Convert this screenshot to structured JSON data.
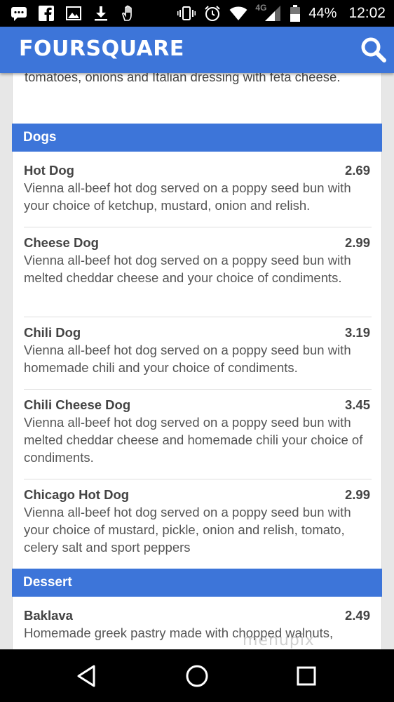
{
  "status_bar": {
    "network": "4G",
    "battery": "44%",
    "time": "12:02"
  },
  "app": {
    "title": "FOURSQUARE"
  },
  "previous_item": {
    "desc_tail": "tomatoes, onions and Italian dressing with feta cheese."
  },
  "sections": [
    {
      "title": "Dogs",
      "items": [
        {
          "name": "Hot Dog",
          "price": "2.69",
          "desc": "Vienna all-beef hot dog served on a poppy seed bun with your choice of ketchup, mustard, onion and relish."
        },
        {
          "name": "Cheese Dog",
          "price": "2.99",
          "desc": "Vienna all-beef hot dog served on a poppy seed bun with melted cheddar cheese and your choice of condiments."
        },
        {
          "name": "Chili Dog",
          "price": "3.19",
          "desc": "Vienna all-beef hot dog served on a poppy seed bun with homemade chili and your choice of condiments."
        },
        {
          "name": "Chili Cheese Dog",
          "price": "3.45",
          "desc": "Vienna all-beef hot dog served on a poppy seed bun with melted cheddar cheese and homemade chili your choice of condiments."
        },
        {
          "name": "Chicago Hot Dog",
          "price": "2.99",
          "desc": "Vienna all-beef hot dog served on a poppy seed bun with your choice of mustard, pickle, onion and relish, tomato, celery salt and sport peppers"
        }
      ]
    },
    {
      "title": "Dessert",
      "items": [
        {
          "name": "Baklava",
          "price": "2.49",
          "desc": "Homemade greek pastry made with chopped walnuts,"
        }
      ]
    }
  ],
  "watermark": "menupix",
  "colors": {
    "brand_blue": "#3d75d9",
    "text": "#444444"
  }
}
